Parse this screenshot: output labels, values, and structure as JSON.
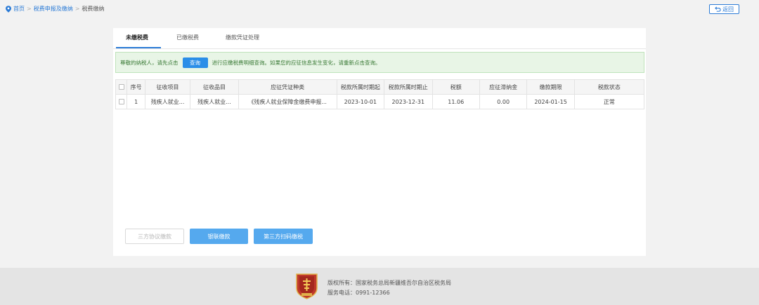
{
  "breadcrumb": {
    "home": "首页",
    "level2": "税费申报及缴纳",
    "current": "税费缴纳",
    "separator": ">"
  },
  "back_button": {
    "label": "返回"
  },
  "tabs": [
    {
      "label": "未缴税费",
      "active": true
    },
    {
      "label": "已缴税费",
      "active": false
    },
    {
      "label": "缴款凭证处理",
      "active": false
    }
  ],
  "notice": {
    "prefix": "尊敬的纳税人，请先点击",
    "button_label": "查询",
    "suffix": "进行应缴税费明细查询。如果您的应征信息发生变化，请重新点击查询。"
  },
  "table": {
    "headers": [
      "序号",
      "征收项目",
      "征收品目",
      "应征凭证种类",
      "税款所属时期起",
      "税款所属时期止",
      "税额",
      "应征滞纳金",
      "缴款期限",
      "税款状态"
    ],
    "rows": [
      [
        "1",
        "残疾人就业...",
        "残疾人就业...",
        "《残疾人就业保障金缴费申报...",
        "2023-10-01",
        "2023-12-31",
        "11.06",
        "0.00",
        "2024-01-15",
        "正常"
      ]
    ]
  },
  "actions": {
    "tripartite_label": "三方协议缴款",
    "unionpay_label": "银联缴款",
    "thirdparty_label": "第三方扫码缴税"
  },
  "footer": {
    "copyright": "版权所有：国家税务总局新疆维吾尔自治区税务局",
    "phone": "服务电话：0991-12366"
  },
  "colors": {
    "accent": "#2b7bd6",
    "button_blue": "#55a9ee",
    "notice_bg": "#e8f5e6",
    "logo_red": "#c0392b"
  },
  "icons": [
    "location-pin-icon",
    "back-arrow-icon",
    "tax-emblem-logo"
  ]
}
